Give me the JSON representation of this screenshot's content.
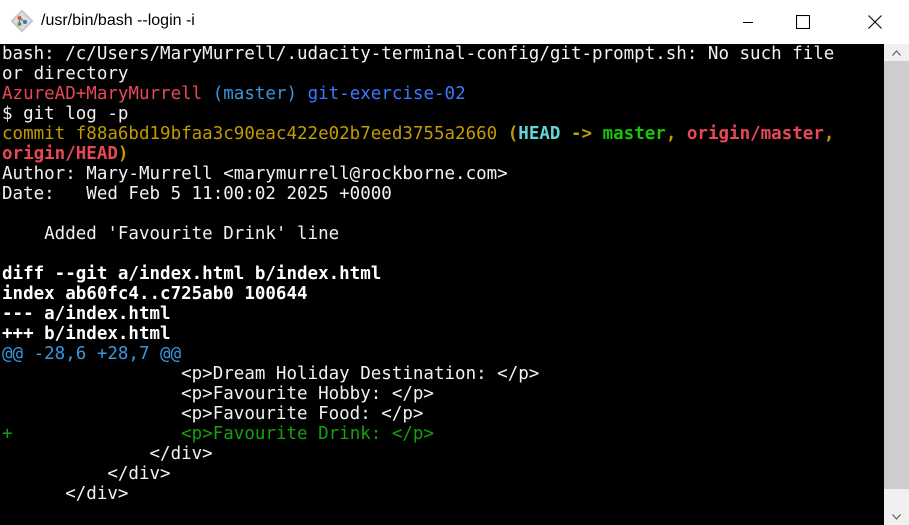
{
  "window": {
    "title": "/usr/bin/bash --login -i",
    "icon": "git-bash-icon"
  },
  "colors": {
    "terminal_bg": "#000000",
    "text": "#f2f2f2",
    "red": "#e74856",
    "cyan": "#3a96dd",
    "blue": "#3b78ff",
    "yellow": "#c19c00",
    "bright_cyan": "#61d6d6",
    "bright_yellow": "#f9f1a5",
    "bright_green": "#16c60c",
    "green": "#13a10e",
    "teal": "#3a96dd"
  },
  "terminal": {
    "lines": [
      [
        {
          "text": "bash: /c/Users/MaryMurrell/.udacity-terminal-config/git-prompt.sh: No such file",
          "color": "#f2f2f2"
        }
      ],
      [
        {
          "text": "or directory",
          "color": "#f2f2f2"
        }
      ],
      [
        {
          "text": "AzureAD+MaryMurrell",
          "color": "#e74856"
        },
        {
          "text": " ",
          "color": "#f2f2f2"
        },
        {
          "text": "(master)",
          "color": "#3a96dd"
        },
        {
          "text": " ",
          "color": "#f2f2f2"
        },
        {
          "text": "git-exercise-02",
          "color": "#3b78ff"
        }
      ],
      [
        {
          "text": "$ git log -p",
          "color": "#f2f2f2"
        }
      ],
      [
        {
          "text": "commit f88a6bd19bfaa3c90eac422e02b7eed3755a2660 ",
          "color": "#c19c00"
        },
        {
          "text": "(",
          "color": "#c19c00",
          "bold": true
        },
        {
          "text": "HEAD",
          "color": "#61d6d6",
          "bold": true
        },
        {
          "text": " -> ",
          "color": "#c19c00",
          "bold": true
        },
        {
          "text": "master",
          "color": "#16c60c",
          "bold": true
        },
        {
          "text": ", ",
          "color": "#c19c00",
          "bold": true
        },
        {
          "text": "origin/master",
          "color": "#e74856",
          "bold": true
        },
        {
          "text": ",",
          "color": "#c19c00",
          "bold": true
        }
      ],
      [
        {
          "text": "origin/HEAD",
          "color": "#e74856",
          "bold": true
        },
        {
          "text": ")",
          "color": "#c19c00",
          "bold": true
        }
      ],
      [
        {
          "text": "Author: Mary-Murrell <marymurrell@rockborne.com>",
          "color": "#f2f2f2"
        }
      ],
      [
        {
          "text": "Date:   Wed Feb 5 11:00:02 2025 +0000",
          "color": "#f2f2f2"
        }
      ],
      [
        {
          "text": "",
          "color": "#f2f2f2"
        }
      ],
      [
        {
          "text": "    Added 'Favourite Drink' line",
          "color": "#f2f2f2"
        }
      ],
      [
        {
          "text": "",
          "color": "#f2f2f2"
        }
      ],
      [
        {
          "text": "diff --git a/index.html b/index.html",
          "color": "#ffffff",
          "bold": true
        }
      ],
      [
        {
          "text": "index ab60fc4..c725ab0 100644",
          "color": "#ffffff",
          "bold": true
        }
      ],
      [
        {
          "text": "--- a/index.html",
          "color": "#ffffff",
          "bold": true
        }
      ],
      [
        {
          "text": "+++ b/index.html",
          "color": "#ffffff",
          "bold": true
        }
      ],
      [
        {
          "text": "@@ -28,6 +28,7 @@",
          "color": "#3a96dd"
        }
      ],
      [
        {
          "text": "                 <p>Dream Holiday Destination: </p>",
          "color": "#f2f2f2"
        }
      ],
      [
        {
          "text": "                 <p>Favourite Hobby: </p>",
          "color": "#f2f2f2"
        }
      ],
      [
        {
          "text": "                 <p>Favourite Food: </p>",
          "color": "#f2f2f2"
        }
      ],
      [
        {
          "text": "+",
          "color": "#13a10e"
        },
        {
          "text": "                <p>Favourite Drink: </p>",
          "color": "#13a10e"
        }
      ],
      [
        {
          "text": "              </div>",
          "color": "#f2f2f2"
        }
      ],
      [
        {
          "text": "          </div>",
          "color": "#f2f2f2"
        }
      ],
      [
        {
          "text": "      </div>",
          "color": "#f2f2f2"
        }
      ]
    ]
  },
  "scrollbar": {
    "up_icon": "scroll-up-arrow-icon",
    "down_icon": "scroll-down-arrow-icon"
  }
}
